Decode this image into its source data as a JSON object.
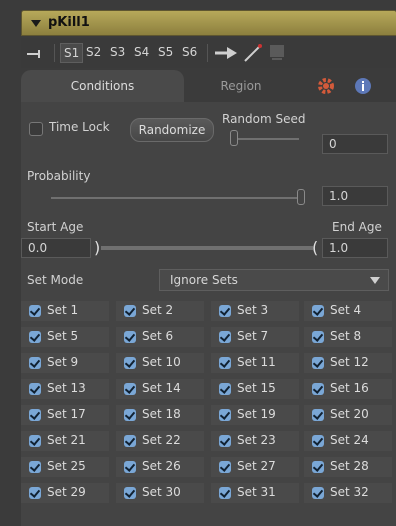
{
  "header": {
    "title": "pKill1"
  },
  "toolbar": {
    "items": [
      "S1",
      "S2",
      "S3",
      "S4",
      "S5",
      "S6"
    ],
    "active": "S1"
  },
  "tabs": {
    "conditions": "Conditions",
    "region": "Region"
  },
  "controls": {
    "time_lock": "Time Lock",
    "randomize": "Randomize",
    "random_seed_label": "Random Seed",
    "random_seed_value": "0",
    "probability_label": "Probability",
    "probability_value": "1.0",
    "start_age_label": "Start Age",
    "end_age_label": "End Age",
    "start_age_value": "0.0",
    "end_age_value": "1.0",
    "set_mode_label": "Set Mode",
    "set_mode_value": "Ignore Sets"
  },
  "sets": [
    "Set 1",
    "Set 2",
    "Set 3",
    "Set 4",
    "Set 5",
    "Set 6",
    "Set 7",
    "Set 8",
    "Set 9",
    "Set 10",
    "Set 11",
    "Set 12",
    "Set 13",
    "Set 14",
    "Set 15",
    "Set 16",
    "Set 17",
    "Set 18",
    "Set 19",
    "Set 20",
    "Set 21",
    "Set 22",
    "Set 23",
    "Set 24",
    "Set 25",
    "Set 26",
    "Set 27",
    "Set 28",
    "Set 29",
    "Set 30",
    "Set 31",
    "Set 32"
  ]
}
